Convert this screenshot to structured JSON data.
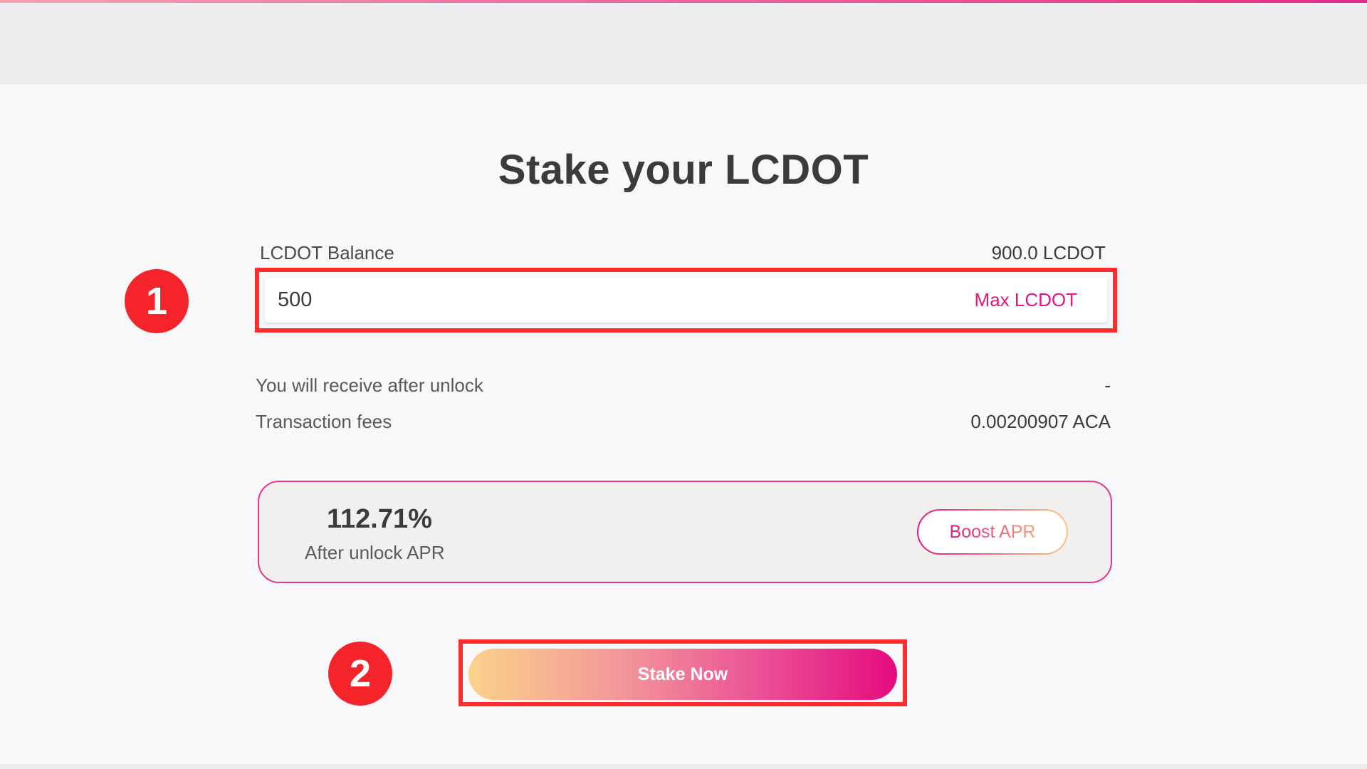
{
  "page": {
    "title": "Stake your LCDOT"
  },
  "balance": {
    "label": "LCDOT Balance",
    "value": "900.0 LCDOT"
  },
  "amount_input": {
    "value": "500",
    "max_label": "Max LCDOT"
  },
  "summary": {
    "receive_label": "You will receive after unlock",
    "receive_value": "-",
    "fees_label": "Transaction fees",
    "fees_value": "0.00200907 ACA"
  },
  "apr_card": {
    "value": "112.71%",
    "label": "After unlock APR",
    "boost_label": "Boost APR"
  },
  "stake_button": {
    "label": "Stake Now"
  },
  "annotations": {
    "step1": "1",
    "step2": "2"
  },
  "colors": {
    "accent": "#e6157f",
    "highlight_box": "#ff2d2d",
    "badge": "#f5242b"
  }
}
